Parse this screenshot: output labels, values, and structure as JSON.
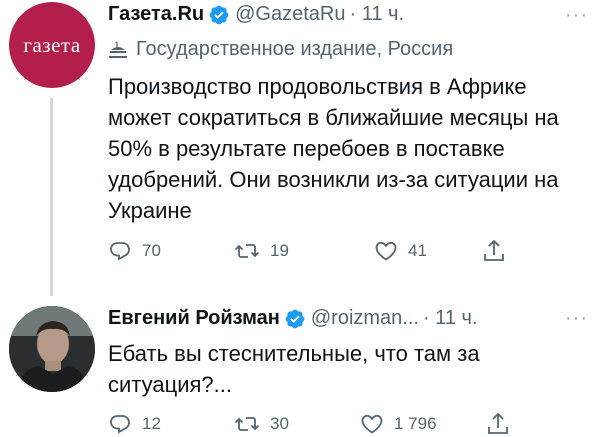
{
  "tweet1": {
    "name": "Газета.Ru",
    "handle": "@GazetaRu",
    "time": "· 11 ч.",
    "more": "···",
    "avatar_text": "газета",
    "label": "Государственное издание, Россия",
    "text": "Производство продовольствия в Африке может сократиться в ближайшие месяцы на 50% в результате перебоев в поставке удобрений. Они возникли из-за ситуации на Украине",
    "replies": "70",
    "retweets": "19",
    "likes": "41"
  },
  "tweet2": {
    "name": "Евгений Ройзман",
    "handle": "@roizman...",
    "time": "· 11 ч.",
    "more": "···",
    "text": "Ебать вы стеснительные, что там за ситуация?...",
    "replies": "12",
    "retweets": "30",
    "likes": "1 796"
  },
  "colors": {
    "verified": "#1d9bf0",
    "gazeta_brand": "#b41e4a",
    "secondary_text": "#536471"
  },
  "icons": [
    "verified-badge-icon",
    "government-building-icon",
    "reply-icon",
    "retweet-icon",
    "like-icon",
    "share-icon",
    "more-icon"
  ]
}
